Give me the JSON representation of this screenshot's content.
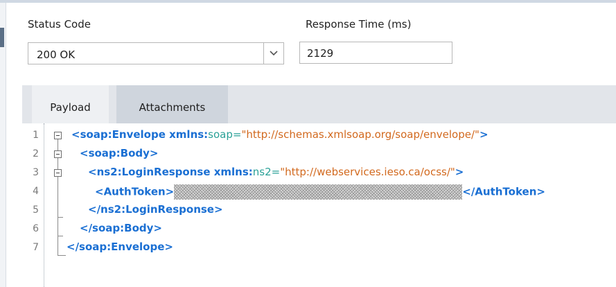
{
  "status_code": {
    "label": "Status Code",
    "selected": "200 OK"
  },
  "response_time": {
    "label": "Response Time (ms)",
    "value": "2129"
  },
  "tabs": [
    {
      "label": "Payload"
    },
    {
      "label": "Attachments"
    }
  ],
  "code": {
    "line_numbers": [
      "1",
      "2",
      "3",
      "4",
      "5",
      "6",
      "7"
    ],
    "l1": {
      "open": "<soap:Envelope xmlns:",
      "attr": "soap=",
      "val": "\"http://schemas.xmlsoap.org/soap/envelope/\"",
      "close": ">"
    },
    "l2": {
      "tag": "<soap:Body>"
    },
    "l3": {
      "open": "<ns2:LoginResponse xmlns:",
      "attr": "ns2=",
      "val": "\"http://webservices.ieso.ca/ocss/\"",
      "close": ">"
    },
    "l4": {
      "open": "<AuthToken>",
      "close": "</AuthToken>"
    },
    "l5": {
      "tag": "</ns2:LoginResponse>"
    },
    "l6": {
      "tag": "</soap:Body>"
    },
    "l7": {
      "tag": "</soap:Envelope>"
    }
  }
}
